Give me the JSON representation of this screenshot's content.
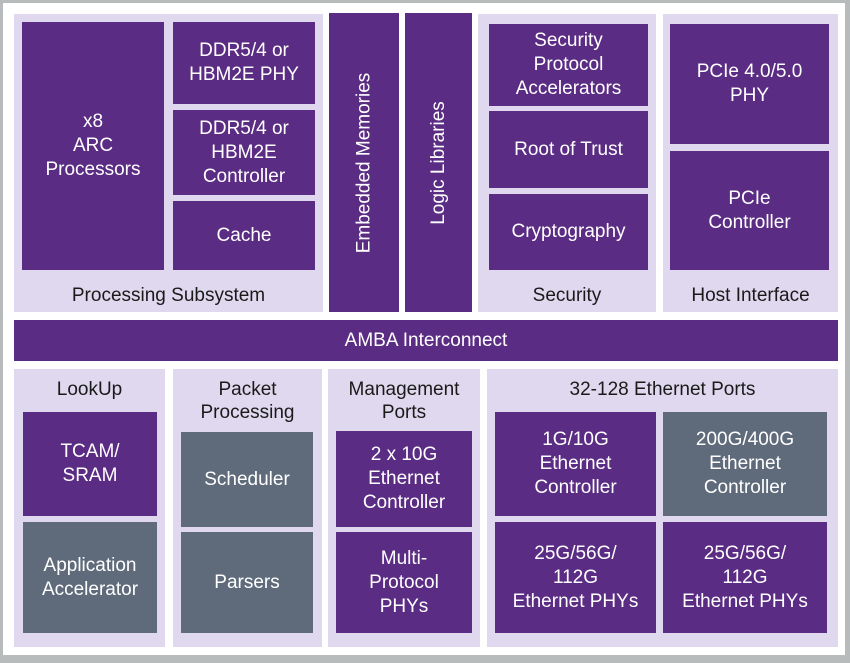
{
  "colors": {
    "block_primary": "#5b2c83",
    "block_secondary": "#5f6b7b",
    "panel_background": "#e0d8ee",
    "label_text": "#1a1a1a",
    "block_text": "#ffffff"
  },
  "processing_subsystem": {
    "label": "Processing Subsystem",
    "blocks": [
      "x8\nARC\nProcessors",
      "DDR5/4 or\nHBM2E PHY",
      "DDR5/4 or\nHBM2E\nController",
      "Cache"
    ]
  },
  "embedded_memories": "Embedded Memories",
  "logic_libraries": "Logic Libraries",
  "security": {
    "label": "Security",
    "blocks": [
      "Security\nProtocol\nAccelerators",
      "Root of Trust",
      "Cryptography"
    ]
  },
  "host_interface": {
    "label": "Host Interface",
    "blocks": [
      "PCIe 4.0/5.0\nPHY",
      "PCIe\nController"
    ]
  },
  "interconnect": "AMBA Interconnect",
  "lookup": {
    "label": "LookUp",
    "blocks": [
      "TCAM/\nSRAM",
      "Application\nAccelerator"
    ]
  },
  "packet_processing": {
    "label": "Packet\nProcessing",
    "blocks": [
      "Scheduler",
      "Parsers"
    ]
  },
  "management_ports": {
    "label": "Management\nPorts",
    "blocks": [
      "2 x 10G\nEthernet\nController",
      "Multi-\nProtocol\nPHYs"
    ]
  },
  "ethernet_ports": {
    "label": "32-128 Ethernet Ports",
    "blocks": [
      "1G/10G\nEthernet\nController",
      "200G/400G\nEthernet\nController",
      "25G/56G/\n112G\nEthernet PHYs",
      "25G/56G/\n112G\nEthernet PHYs"
    ]
  }
}
